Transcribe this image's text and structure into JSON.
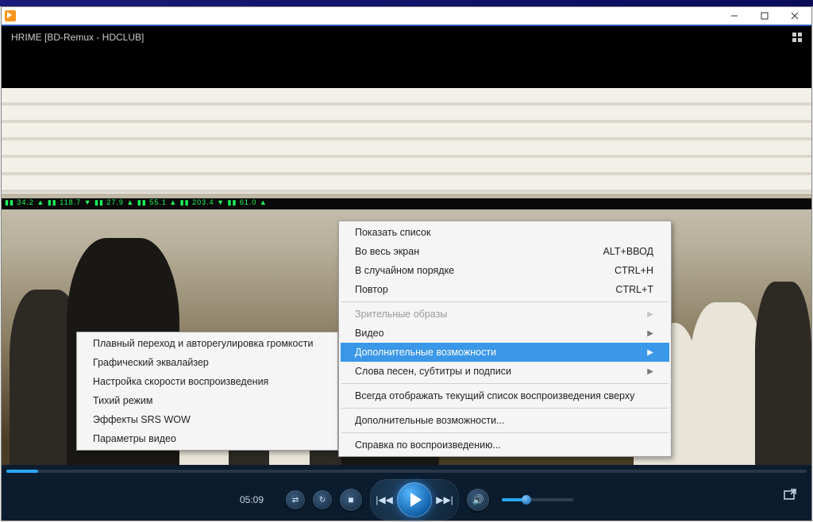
{
  "window": {
    "video_title": "HRIME [BD-Remux - HDCLUB]"
  },
  "submenu": {
    "items": [
      "Плавный переход и авторегулировка громкости",
      "Графический эквалайзер",
      "Настройка скорости воспроизведения",
      "Тихий режим",
      "Эффекты SRS WOW",
      "Параметры видео"
    ]
  },
  "mainmenu": {
    "items": [
      {
        "label": "Показать список",
        "shortcut": ""
      },
      {
        "label": "Во весь экран",
        "shortcut": "ALT+ВВОД"
      },
      {
        "label": "В случайном порядке",
        "shortcut": "CTRL+H"
      },
      {
        "label": "Повтор",
        "shortcut": "CTRL+T"
      },
      {
        "sep": true
      },
      {
        "label": "Зрительные образы",
        "arrow": true,
        "disabled": true
      },
      {
        "label": "Видео",
        "arrow": true
      },
      {
        "label": "Дополнительные возможности",
        "arrow": true,
        "highlight": true
      },
      {
        "label": "Слова песен, субтитры и подписи",
        "arrow": true
      },
      {
        "sep": true
      },
      {
        "label": "Всегда отображать текущий список воспроизведения сверху"
      },
      {
        "sep": true
      },
      {
        "label": "Дополнительные возможности..."
      },
      {
        "sep": true
      },
      {
        "label": "Справка по воспроизведению..."
      }
    ]
  },
  "playback": {
    "time": "05:09",
    "seek_percent": 4,
    "volume_percent": 30
  },
  "ticker": "▮▮ 34.2 ▲  ▮▮ 118.7 ▼  ▮▮ 27.9 ▲  ▮▮ 55.1 ▲  ▮▮ 203.4 ▼  ▮▮ 61.0 ▲"
}
